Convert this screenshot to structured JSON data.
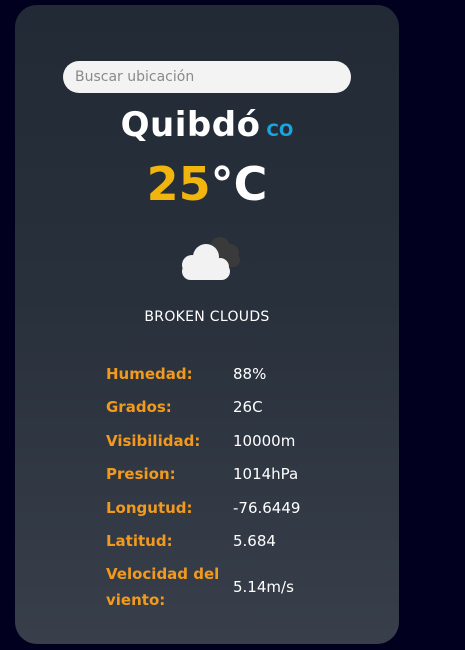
{
  "search": {
    "placeholder": "Buscar ubicación",
    "value": ""
  },
  "location": {
    "city": "Quibdó",
    "country": "CO"
  },
  "temperature": {
    "value": "25",
    "unit": "°C"
  },
  "weather": {
    "description": "BROKEN CLOUDS",
    "icon": "broken-clouds-icon"
  },
  "details": [
    {
      "label": "Humedad:",
      "value": "88%"
    },
    {
      "label": "Grados:",
      "value": "26C"
    },
    {
      "label": "Visibilidad:",
      "value": "10000m"
    },
    {
      "label": "Presion:",
      "value": "1014hPa"
    },
    {
      "label": "Longutud:",
      "value": "-76.6449"
    },
    {
      "label": "Latitud:",
      "value": "5.684"
    },
    {
      "label": "Velocidad del viento:",
      "value": "5.14m/s"
    }
  ],
  "colors": {
    "background": "#01001f",
    "accent_label": "#f29a1c",
    "temperature": "#f1b50e",
    "country": "#1aa5e0"
  }
}
